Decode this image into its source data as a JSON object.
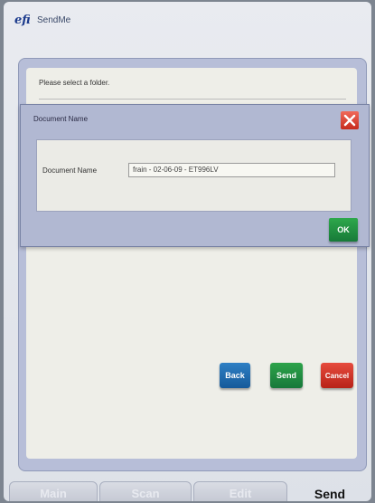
{
  "app": {
    "logo": "efi",
    "name": "SendMe"
  },
  "main": {
    "prompt": "Please select a folder."
  },
  "dialog": {
    "title": "Document Name",
    "field_label": "Document Name",
    "field_value": "frain - 02-06-09 - ET996LV",
    "ok_label": "OK"
  },
  "actions": {
    "back_label": "Back",
    "send_label": "Send",
    "cancel_label": "Cancel"
  },
  "tabs": [
    {
      "label": "Main",
      "active": false
    },
    {
      "label": "Scan",
      "active": false
    },
    {
      "label": "Edit",
      "active": false
    },
    {
      "label": "Send",
      "active": true
    }
  ],
  "colors": {
    "ok": "#2ea84c",
    "back": "#2e7fc4",
    "send": "#2da34a",
    "cancel": "#e64b3d",
    "close": "#e04a3a"
  }
}
